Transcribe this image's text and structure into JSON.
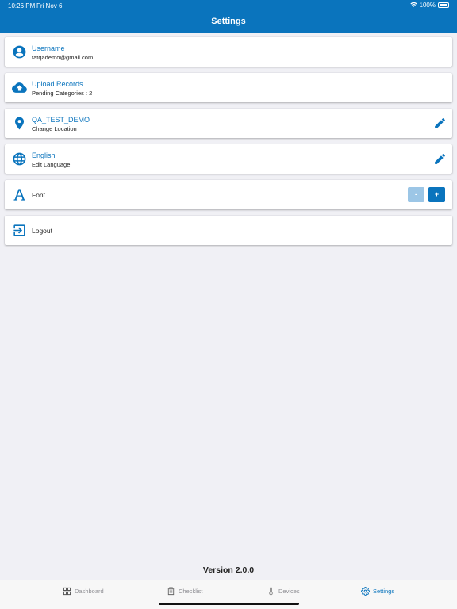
{
  "status_bar": {
    "time": "10:26 PM",
    "date": "Fri Nov 6",
    "battery": "100%"
  },
  "header": {
    "title": "Settings"
  },
  "settings": {
    "username": {
      "title": "Username",
      "value": "tatqademo@gmail.com",
      "icon": "account-circle-icon"
    },
    "upload": {
      "title": "Upload Records",
      "value": "Pending Categories : 2",
      "icon": "cloud-upload-icon"
    },
    "location": {
      "title": "QA_TEST_DEMO",
      "value": "Change Location",
      "icon": "location-pin-icon",
      "action_icon": "pencil-icon"
    },
    "language": {
      "title": "English",
      "value": "Edit Language",
      "icon": "globe-icon",
      "action_icon": "pencil-icon"
    },
    "font": {
      "label": "Font",
      "icon": "font-letter-icon",
      "decrease_label": "-",
      "increase_label": "+"
    },
    "logout": {
      "label": "Logout",
      "icon": "logout-icon"
    }
  },
  "footer": {
    "version": "Version 2.0.0"
  },
  "tabs": [
    {
      "label": "Dashboard",
      "icon": "dashboard-grid-icon",
      "active": false
    },
    {
      "label": "Checklist",
      "icon": "clipboard-icon",
      "active": false
    },
    {
      "label": "Devices",
      "icon": "thermometer-icon",
      "active": false
    },
    {
      "label": "Settings",
      "icon": "gear-icon",
      "active": true
    }
  ],
  "colors": {
    "primary": "#0a74bd",
    "background": "#f0f0f5",
    "disabled_button": "#9cc6e6",
    "inactive_tab": "#8e8e93"
  }
}
